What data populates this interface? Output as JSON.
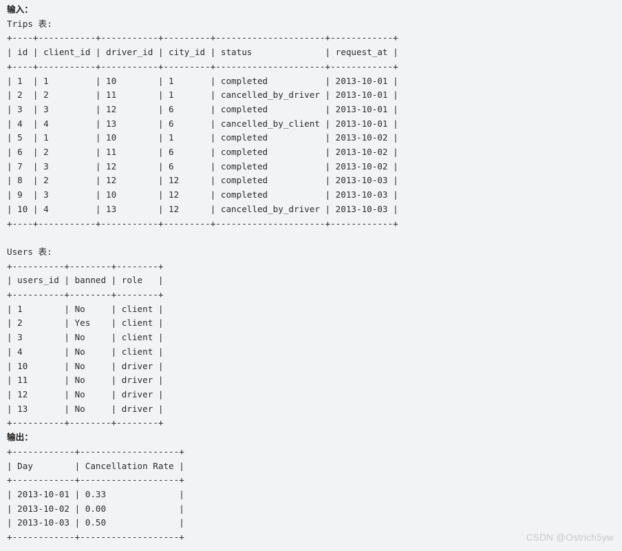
{
  "page": {
    "background_color": "#f2f3f5",
    "text_color": "#2b2b2b"
  },
  "input_section": {
    "heading": "输入：",
    "trips_caption": "Trips 表:",
    "trips_table": {
      "sep": "+----+-----------+-----------+---------+---------------------+------------+",
      "header": "| id | client_id | driver_id | city_id | status              | request_at |",
      "columns": [
        "id",
        "client_id",
        "driver_id",
        "city_id",
        "status",
        "request_at"
      ],
      "rows": [
        [
          "1",
          "1",
          "10",
          "1",
          "completed",
          "2013-10-01"
        ],
        [
          "2",
          "2",
          "11",
          "1",
          "cancelled_by_driver",
          "2013-10-01"
        ],
        [
          "3",
          "3",
          "12",
          "6",
          "completed",
          "2013-10-01"
        ],
        [
          "4",
          "4",
          "13",
          "6",
          "cancelled_by_client",
          "2013-10-01"
        ],
        [
          "5",
          "1",
          "10",
          "1",
          "completed",
          "2013-10-02"
        ],
        [
          "6",
          "2",
          "11",
          "6",
          "completed",
          "2013-10-02"
        ],
        [
          "7",
          "3",
          "12",
          "6",
          "completed",
          "2013-10-02"
        ],
        [
          "8",
          "2",
          "12",
          "12",
          "completed",
          "2013-10-03"
        ],
        [
          "9",
          "3",
          "10",
          "12",
          "completed",
          "2013-10-03"
        ],
        [
          "10",
          "4",
          "13",
          "12",
          "cancelled_by_driver",
          "2013-10-03"
        ]
      ],
      "row_lines": [
        "| 1  | 1         | 10        | 1       | completed           | 2013-10-01 |",
        "| 2  | 2         | 11        | 1       | cancelled_by_driver | 2013-10-01 |",
        "| 3  | 3         | 12        | 6       | completed           | 2013-10-01 |",
        "| 4  | 4         | 13        | 6       | cancelled_by_client | 2013-10-01 |",
        "| 5  | 1         | 10        | 1       | completed           | 2013-10-02 |",
        "| 6  | 2         | 11        | 6       | completed           | 2013-10-02 |",
        "| 7  | 3         | 12        | 6       | completed           | 2013-10-02 |",
        "| 8  | 2         | 12        | 12      | completed           | 2013-10-03 |",
        "| 9  | 3         | 10        | 12      | completed           | 2013-10-03 |",
        "| 10 | 4         | 13        | 12      | cancelled_by_driver | 2013-10-03 |"
      ]
    },
    "users_caption": "Users 表:",
    "users_table": {
      "sep": "+----------+--------+--------+",
      "header": "| users_id | banned | role   |",
      "columns": [
        "users_id",
        "banned",
        "role"
      ],
      "rows": [
        [
          "1",
          "No",
          "client"
        ],
        [
          "2",
          "Yes",
          "client"
        ],
        [
          "3",
          "No",
          "client"
        ],
        [
          "4",
          "No",
          "client"
        ],
        [
          "10",
          "No",
          "driver"
        ],
        [
          "11",
          "No",
          "driver"
        ],
        [
          "12",
          "No",
          "driver"
        ],
        [
          "13",
          "No",
          "driver"
        ]
      ],
      "row_lines": [
        "| 1        | No     | client |",
        "| 2        | Yes    | client |",
        "| 3        | No     | client |",
        "| 4        | No     | client |",
        "| 10       | No     | driver |",
        "| 11       | No     | driver |",
        "| 12       | No     | driver |",
        "| 13       | No     | driver |"
      ]
    }
  },
  "output_section": {
    "heading": "输出：",
    "output_table": {
      "sep": "+------------+-------------------+",
      "header": "| Day        | Cancellation Rate |",
      "columns": [
        "Day",
        "Cancellation Rate"
      ],
      "rows": [
        [
          "2013-10-01",
          "0.33"
        ],
        [
          "2013-10-02",
          "0.00"
        ],
        [
          "2013-10-03",
          "0.50"
        ]
      ],
      "row_lines": [
        "| 2013-10-01 | 0.33              |",
        "| 2013-10-02 | 0.00              |",
        "| 2013-10-03 | 0.50              |"
      ]
    }
  },
  "watermark": {
    "text": "CSDN @Ostrich5yw",
    "color": "#c6c9cc"
  }
}
